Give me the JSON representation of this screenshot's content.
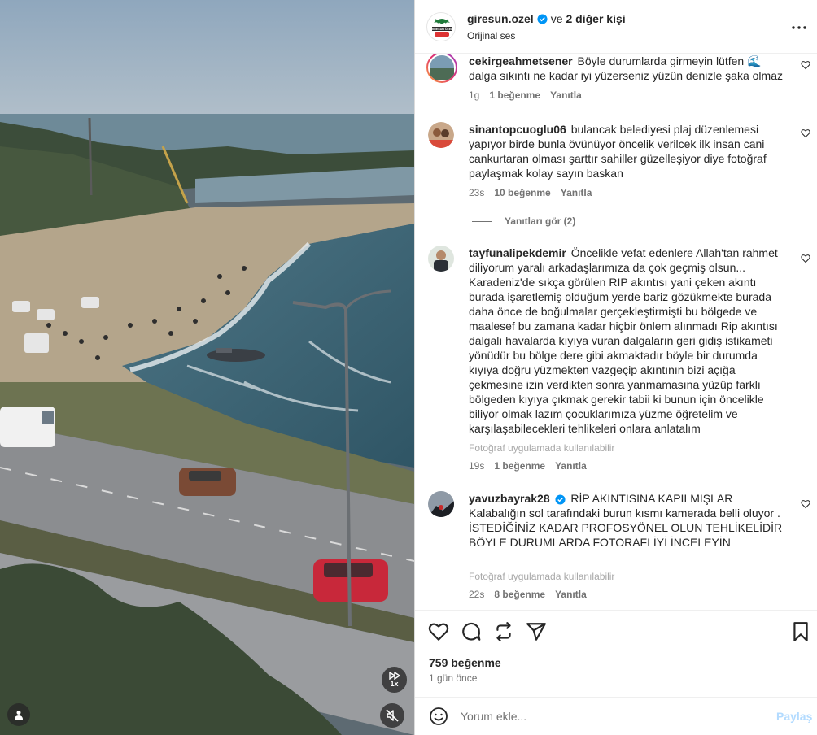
{
  "header": {
    "username": "giresun.ozel",
    "and_text": "ve",
    "others_text": "2 diğer kişi",
    "subtitle": "Orijinal ses",
    "avatar_text": "GİRESUN ÖZEL"
  },
  "comments": [
    {
      "username": "cekirgeahmetsener",
      "text": "Böyle durumlarda girmeyin lütfen 🌊 dalga sıkıntı ne kadar iyi yüzerseniz yüzün denizle şaka olmaz",
      "time": "1g",
      "likes": "1 beğenme",
      "reply": "Yanıtla"
    },
    {
      "username": "sinantopcuoglu06",
      "text": "bulancak belediyesi plaj düzenlemesi yapıyor birde bunla övünüyor öncelik verilcek ilk insan cani cankurtaran olması şarttır sahiller güzelleşiyor diye fotoğraf paylaşmak kolay sayın baskan",
      "time": "23s",
      "likes": "10 beğenme",
      "reply": "Yanıtla",
      "view_replies": "Yanıtları gör (2)"
    },
    {
      "username": "tayfunalipekdemir",
      "text": "Öncelikle vefat edenlere Allah'tan rahmet diliyorum yaralı arkadaşlarımıza da çok geçmiş olsun... Karadeniz'de sıkça görülen RIP akıntısı yani çeken akıntı burada işaretlemiş olduğum yerde bariz gözükmekte burada daha önce de boğulmalar gerçekleştirmişti bu bölgede ve maalesef bu zamana kadar hiçbir önlem alınmadı Rip akıntısı dalgalı havalarda kıyıya vuran dalgaların geri gidiş istikameti yönüdür bu bölge dere gibi akmaktadır böyle bir durumda kıyıya doğru yüzmekten vazgeçip akıntının bizi açığa çekmesine izin verdikten sonra yanmamasına yüzüp farklı bölgeden kıyıya çıkmak gerekir tabii ki bunun için öncelikle biliyor olmak lazım çocuklarımıza yüzme öğretelim ve karşılaşabilecekleri tehlikeleri onlara anlatalım",
      "note": "Fotoğraf uygulamada kullanılabilir",
      "time": "19s",
      "likes": "1 beğenme",
      "reply": "Yanıtla"
    },
    {
      "username": "yavuzbayrak28",
      "text": "RİP AKINTISINA KAPILMIŞLAR Kalabalığın sol tarafındaki burun kısmı kamerada belli oluyor . İSTEDİĞİNİZ KADAR PROFOSYÖNEL OLUN TEHLİKELİDİR BÖYLE DURUMLARDA FOTORAFI İYİ İNCELEYİN",
      "note": "Fotoğraf uygulamada kullanılabilir",
      "time": "22s",
      "likes": "8 beğenme",
      "reply": "Yanıtla"
    }
  ],
  "post": {
    "likes": "759 beğenme",
    "time_ago": "1 gün önce"
  },
  "add_comment": {
    "placeholder": "Yorum ekle...",
    "share_label": "Paylaş"
  },
  "media": {
    "speed_label": "1x"
  },
  "colors": {
    "accent_blue": "#0095f6",
    "share_disabled": "#b3dbff",
    "secondary_text": "#737373"
  }
}
